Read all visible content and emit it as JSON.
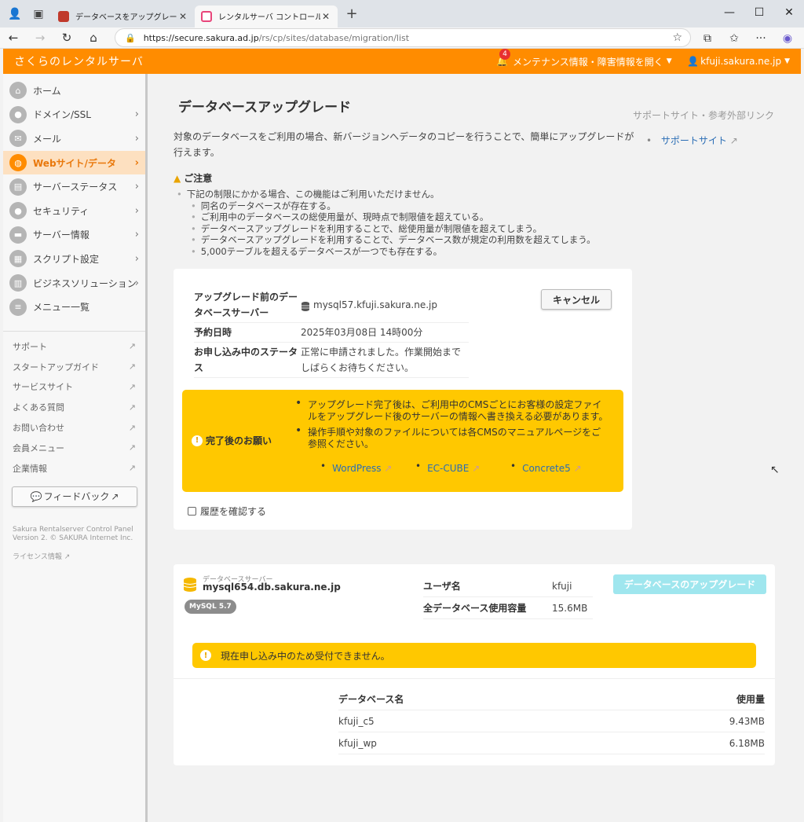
{
  "browser": {
    "tabs": [
      {
        "title": "データベースをアップグレードしたい | さくら",
        "active": false
      },
      {
        "title": "レンタルサーバ コントロールパネル",
        "active": true
      }
    ],
    "url_host": "https://secure.sakura.ad.jp",
    "url_path": "/rs/cp/sites/database/migration/list"
  },
  "header": {
    "brand": "さくらのレンタルサーバ",
    "notification_count": "4",
    "maintenance_label": "メンテナンス情報・障害情報を開く",
    "user": "kfuji.sakura.ne.jp"
  },
  "sidebar": {
    "items": [
      {
        "label": "ホーム",
        "has_chevron": false,
        "active": false,
        "icon": "home-icon"
      },
      {
        "label": "ドメイン/SSL",
        "has_chevron": true,
        "active": false,
        "icon": "lock-icon"
      },
      {
        "label": "メール",
        "has_chevron": true,
        "active": false,
        "icon": "mail-icon"
      },
      {
        "label": "Webサイト/データ",
        "has_chevron": true,
        "active": true,
        "icon": "globe-icon"
      },
      {
        "label": "サーバーステータス",
        "has_chevron": true,
        "active": false,
        "icon": "chart-icon"
      },
      {
        "label": "セキュリティ",
        "has_chevron": true,
        "active": false,
        "icon": "lock-icon"
      },
      {
        "label": "サーバー情報",
        "has_chevron": true,
        "active": false,
        "icon": "server-icon"
      },
      {
        "label": "スクリプト設定",
        "has_chevron": true,
        "active": false,
        "icon": "script-icon"
      },
      {
        "label": "ビジネスソリューション",
        "has_chevron": true,
        "active": false,
        "icon": "building-icon"
      },
      {
        "label": "メニュー一覧",
        "has_chevron": false,
        "active": false,
        "icon": "list-icon"
      }
    ],
    "links": [
      "サポート",
      "スタートアップガイド",
      "サービスサイト",
      "よくある質問",
      "お問い合わせ",
      "会員メニュー",
      "企業情報"
    ],
    "feedback": "フィードバック",
    "footer_line1": "Sakura Rentalserver Control Panel",
    "footer_line2": "Version 2. © SAKURA Internet Inc.",
    "license": "ライセンス情報"
  },
  "main": {
    "title": "データベースアップグレード",
    "intro": "対象のデータベースをご利用の場合、新バージョンへデータのコピーを行うことで、簡単にアップグレードが行えます。",
    "caution_title": "ご注意",
    "caution_lead": "下記の制限にかかる場合、この機能はご利用いただけません。",
    "caution_items": [
      "同名のデータベースが存在する。",
      "ご利用中のデータベースの総使用量が、現時点で制限値を超えている。",
      "データベースアップグレードを利用することで、総使用量が制限値を超えてしまう。",
      "データベースアップグレードを利用することで、データベース数が規定の利用数を超えてしまう。",
      "5,000テーブルを超えるデータベースが一つでも存在する。"
    ],
    "support_heading": "サポートサイト・参考外部リンク",
    "support_link": "サポートサイト"
  },
  "reservation": {
    "rows": [
      {
        "key": "アップグレード前のデータベースサーバー",
        "value": "mysql57.kfuji.sakura.ne.jp"
      },
      {
        "key": "予約日時",
        "value": "2025年03月08日 14時00分"
      },
      {
        "key": "お申し込み中のステータス",
        "value": "正常に申請されました。作業開始までしばらくお待ちください。"
      }
    ],
    "cancel": "キャンセル",
    "notice_title": "完了後のお願い",
    "notice_items": [
      "アップグレード完了後は、ご利用中のCMSごとにお客様の設定ファイルをアップグレード後のサーバーの情報へ書き換える必要があります。",
      "操作手順や対象のファイルについては各CMSのマニュアルページをご参照ください。"
    ],
    "cms_links": [
      "WordPress",
      "EC-CUBE",
      "Concrete5"
    ],
    "history": "履歴を確認する"
  },
  "server": {
    "caption": "データベースサーバー",
    "name": "mysql654.db.sakura.ne.jp",
    "version_tag": "MySQL 5.7",
    "user_label": "ユーザ名",
    "user_value": "kfuji",
    "usage_label": "全データベース使用容量",
    "usage_value": "15.6MB",
    "upgrade_button": "データベースのアップグレード",
    "warning": "現在申し込み中のため受付できません。",
    "table_headers": [
      "データベース名",
      "使用量"
    ],
    "databases": [
      {
        "name": "kfuji_c5",
        "size": "9.43MB"
      },
      {
        "name": "kfuji_wp",
        "size": "6.18MB"
      }
    ]
  },
  "colors": {
    "brand": "#ff8c00",
    "notice": "#ffc800",
    "link": "#2a6db5",
    "disabled_button": "#9fe6ee"
  }
}
